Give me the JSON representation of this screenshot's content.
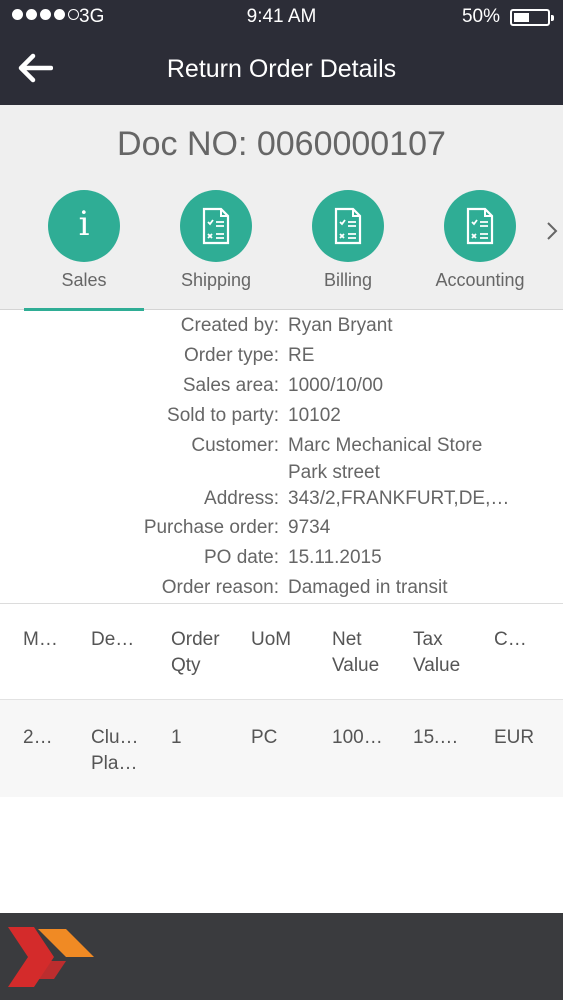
{
  "status": {
    "carrier": "3G",
    "time": "9:41 AM",
    "battery": "50%"
  },
  "nav": {
    "title": "Return Order Details"
  },
  "doc": {
    "title": "Doc NO: 0060000107"
  },
  "tabs": [
    {
      "label": "Sales",
      "icon": "info-icon",
      "active": true
    },
    {
      "label": "Shipping",
      "icon": "document-icon"
    },
    {
      "label": "Billing",
      "icon": "document-icon"
    },
    {
      "label": "Accounting",
      "icon": "document-icon"
    }
  ],
  "details": [
    {
      "key": "Created by:",
      "value": "Ryan Bryant"
    },
    {
      "key": "Order type:",
      "value": "RE"
    },
    {
      "key": "Sales area:",
      "value": "1000/10/00"
    },
    {
      "key": "Sold to party:",
      "value": "10102"
    },
    {
      "key": "Customer:",
      "value": "Marc Mechanical Store"
    },
    {
      "key": "",
      "value": "Park street"
    },
    {
      "key": "Address:",
      "value": "343/2,FRANKFURT,DE,…"
    },
    {
      "key": "Purchase order:",
      "value": "9734"
    },
    {
      "key": "PO date:",
      "value": "15.11.2015"
    },
    {
      "key": "Order reason:",
      "value": "Damaged in transit"
    }
  ],
  "table": {
    "headers": [
      [
        "M…"
      ],
      [
        "De…"
      ],
      [
        "Order",
        "Qty"
      ],
      [
        "UoM"
      ],
      [
        "Net",
        "Value"
      ],
      [
        "Tax",
        "Value"
      ],
      [
        "C…"
      ]
    ],
    "rows": [
      [
        [
          "2…"
        ],
        [
          "Clu…",
          "Pla…"
        ],
        [
          "1"
        ],
        [
          "PC"
        ],
        [
          "100…"
        ],
        [
          "15.…"
        ],
        [
          "EUR"
        ]
      ]
    ]
  },
  "colors": {
    "accent": "#2fad95",
    "navbar": "#2c2d37",
    "footer": "#3a3b3e",
    "logo_red": "#d42b2b",
    "logo_orange": "#f08a24"
  }
}
